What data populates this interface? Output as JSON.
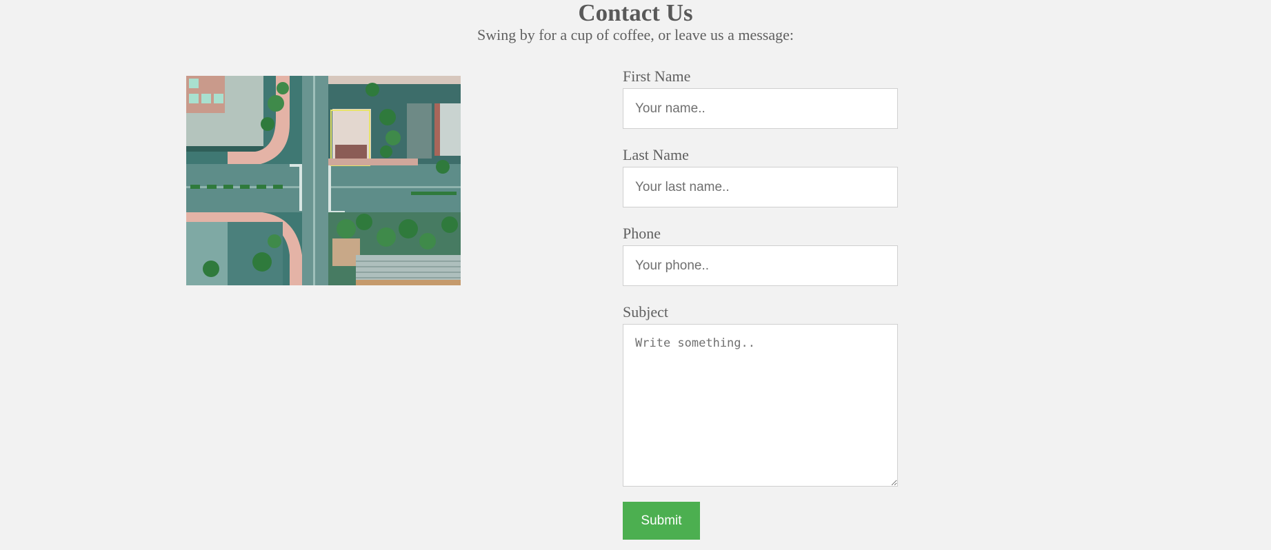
{
  "header": {
    "title": "Contact Us",
    "subtitle": "Swing by for a cup of coffee, or leave us a message:"
  },
  "image": {
    "alt": ""
  },
  "form": {
    "first_name": {
      "label": "First Name",
      "placeholder": "Your name.."
    },
    "last_name": {
      "label": "Last Name",
      "placeholder": "Your last name.."
    },
    "phone": {
      "label": "Phone",
      "placeholder": "Your phone.."
    },
    "subject": {
      "label": "Subject",
      "placeholder": "Write something.."
    },
    "submit_label": "Submit"
  },
  "colors": {
    "background": "#f2f2f2",
    "submit": "#4caf50",
    "text": "#5a5a5a"
  }
}
